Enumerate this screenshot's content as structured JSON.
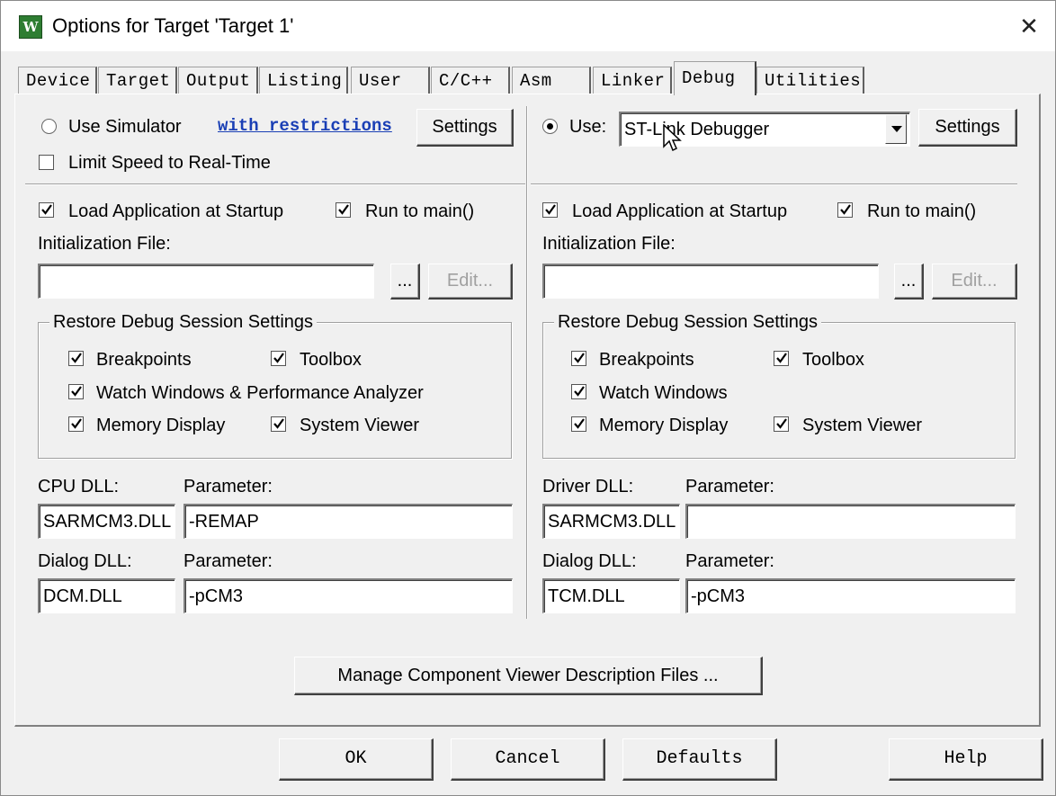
{
  "window": {
    "title": "Options for Target 'Target 1'",
    "icon": "keil-uvision-icon"
  },
  "tabs": [
    "Device",
    "Target",
    "Output",
    "Listing",
    "User",
    "C/C++",
    "Asm",
    "Linker",
    "Debug",
    "Utilities"
  ],
  "active_tab": "Debug",
  "left": {
    "use_simulator": "Use Simulator",
    "with_restrictions": "with restrictions",
    "settings": "Settings",
    "limit_speed": "Limit Speed to Real-Time",
    "load_app": "Load Application at Startup",
    "run_to_main": "Run to main()",
    "init_file_label": "Initialization File:",
    "init_file_value": "",
    "browse": "...",
    "edit": "Edit...",
    "restore_title": "Restore Debug Session Settings",
    "breakpoints": "Breakpoints",
    "toolbox": "Toolbox",
    "watch": "Watch Windows & Performance Analyzer",
    "memory": "Memory Display",
    "system_viewer": "System Viewer",
    "dll1_label": "CPU DLL:",
    "param_label": "Parameter:",
    "dll1_value": "SARMCM3.DLL",
    "param1_value": "-REMAP",
    "dll2_label": "Dialog DLL:",
    "dll2_value": "DCM.DLL",
    "param2_value": "-pCM3"
  },
  "right": {
    "use": "Use:",
    "debugger": "ST-Link Debugger",
    "settings": "Settings",
    "load_app": "Load Application at Startup",
    "run_to_main": "Run to main()",
    "init_file_label": "Initialization File:",
    "init_file_value": "",
    "browse": "...",
    "edit": "Edit...",
    "restore_title": "Restore Debug Session Settings",
    "breakpoints": "Breakpoints",
    "toolbox": "Toolbox",
    "watch": "Watch Windows",
    "memory": "Memory Display",
    "system_viewer": "System Viewer",
    "dll1_label": "Driver DLL:",
    "param_label": "Parameter:",
    "dll1_value": "SARMCM3.DLL",
    "param1_value": "",
    "dll2_label": "Dialog DLL:",
    "dll2_value": "TCM.DLL",
    "param2_value": "-pCM3"
  },
  "manage_button": "Manage Component Viewer Description Files ...",
  "footer": {
    "ok": "OK",
    "cancel": "Cancel",
    "defaults": "Defaults",
    "help": "Help"
  }
}
